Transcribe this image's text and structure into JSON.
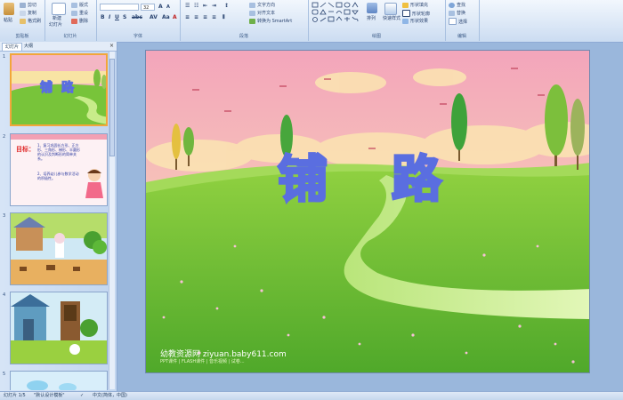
{
  "ribbon": {
    "clipboard": {
      "paste": "粘贴",
      "cut": "剪切",
      "copy": "复制",
      "format_painter": "格式刷",
      "label": "剪贴板"
    },
    "slides": {
      "new_slide": "新建",
      "new_slide_2": "幻灯片",
      "layout": "版式",
      "reset": "重设",
      "delete": "删除",
      "label": "幻灯片"
    },
    "font": {
      "font_name": "",
      "font_size": "32",
      "label": "字体"
    },
    "paragraph": {
      "text_direction": "文字方向",
      "align_text": "对齐文本",
      "convert_smartart": "转换为 SmartArt",
      "label": "段落"
    },
    "drawing": {
      "arrange": "排列",
      "quick_styles": "快速样式",
      "shape_fill": "形状填充",
      "shape_outline": "形状轮廓",
      "shape_effects": "形状效果",
      "label": "绘图"
    },
    "editing": {
      "find": "查找",
      "replace": "替换",
      "select": "选择",
      "label": "编辑"
    }
  },
  "panel": {
    "tab_slides": "幻灯片",
    "tab_outline": "大纲",
    "close": "×",
    "thumbnails": [
      {
        "num": "1",
        "title": "铺路"
      },
      {
        "num": "2",
        "heading": "目标：",
        "line1": "1、复习巩固长方形、正方形、三角形、梯形、半圆形的认识及判断形的简单关系。",
        "line2": "2、培养幼儿参与数学活动的积极性。"
      },
      {
        "num": "3"
      },
      {
        "num": "4"
      },
      {
        "num": "5"
      }
    ]
  },
  "slide": {
    "title": "铺路",
    "watermark": "幼教资源网 ziyuan.baby611.com",
    "watermark_sub": "PPT课件 | FLASH课件 | 音乐视频 | 试卷..."
  },
  "status": {
    "slide_info": "幻灯片 1/5",
    "theme": "\"默认设计模板\"",
    "language": "中文(简体，中国)"
  },
  "colors": {
    "accent": "#f2a63a",
    "title_stroke": "#5a6ee0",
    "grass": "#6cbf2c"
  }
}
